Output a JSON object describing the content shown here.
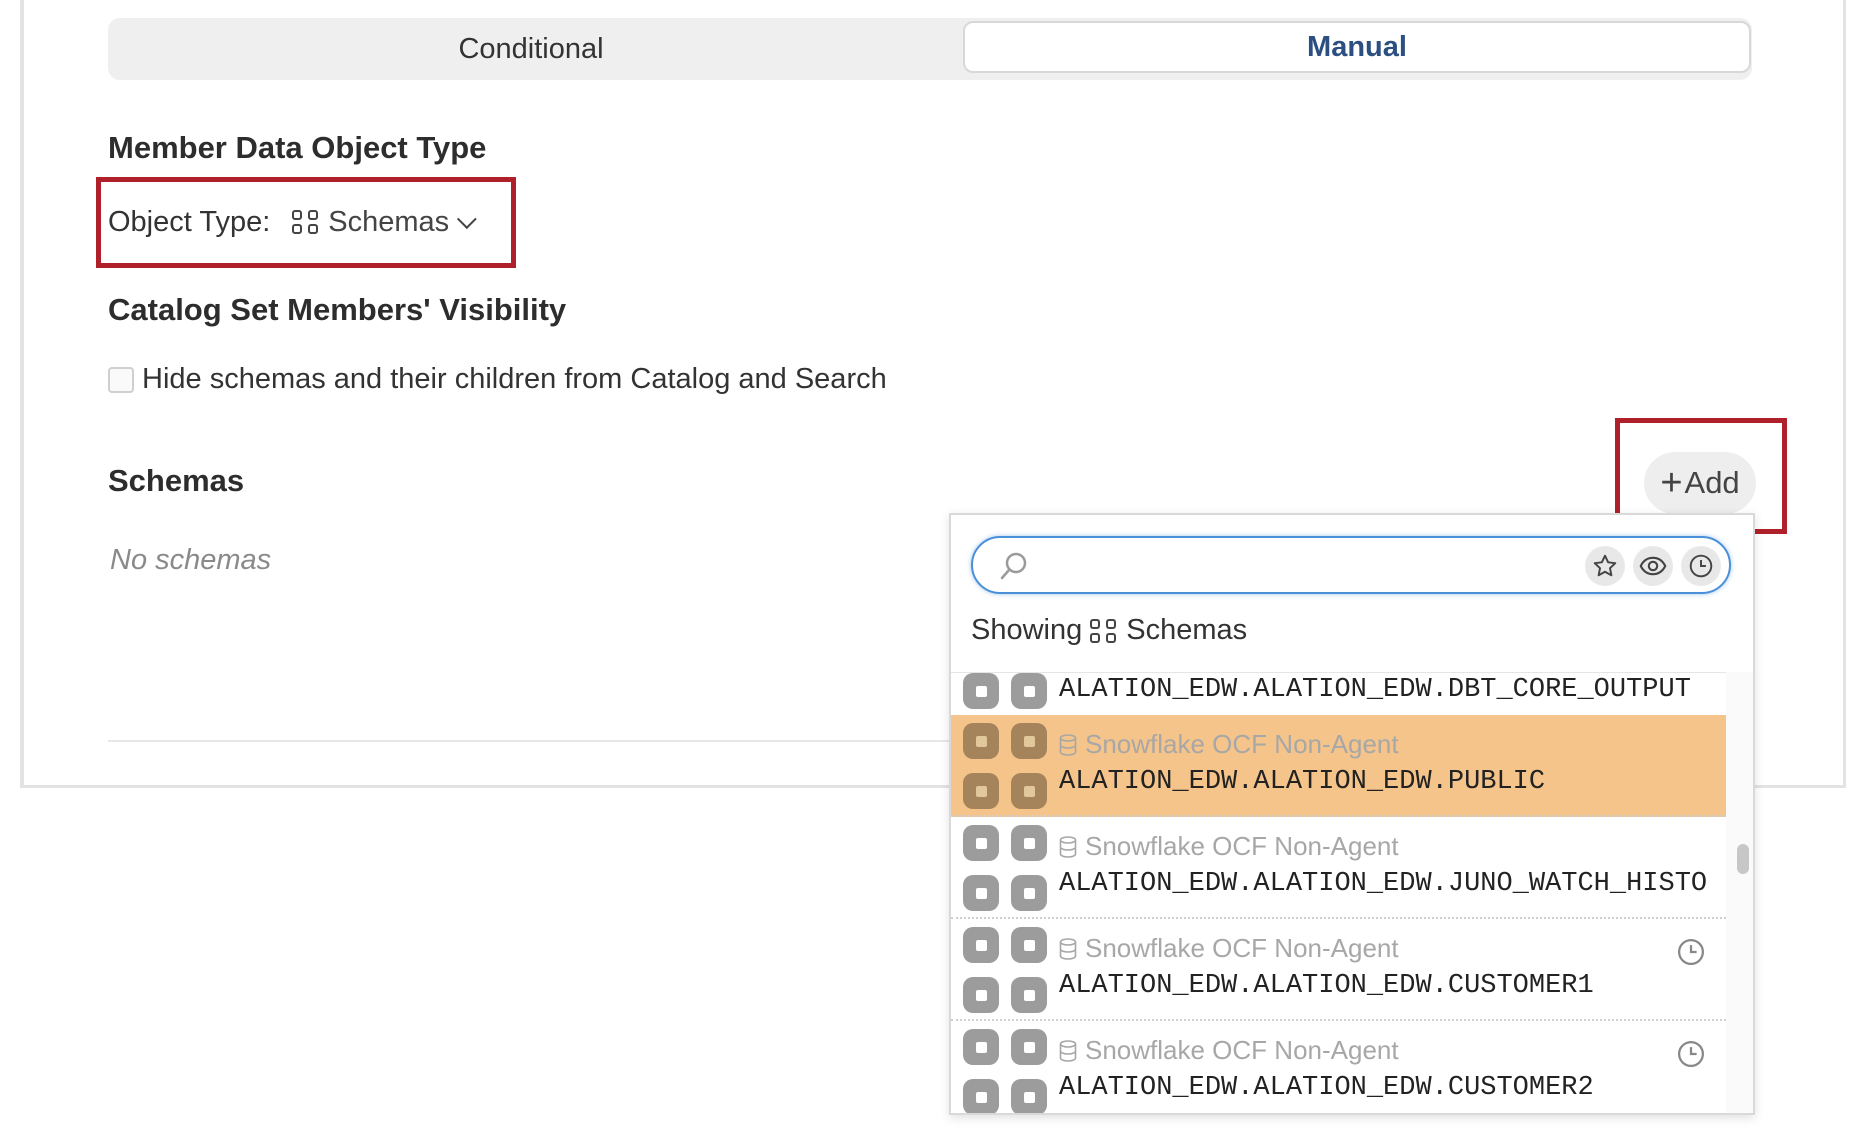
{
  "tabs": {
    "conditional": "Conditional",
    "manual": "Manual",
    "active": "Manual"
  },
  "member_type": {
    "heading": "Member Data Object Type",
    "label": "Object Type:",
    "value": "Schemas",
    "icon": "schema-grid-icon"
  },
  "visibility": {
    "heading": "Catalog Set Members' Visibility",
    "checkbox_label": "Hide schemas and their children from Catalog and Search",
    "checked": false
  },
  "schemas": {
    "heading": "Schemas",
    "empty_text": "No schemas",
    "add_label": "Add"
  },
  "dropdown": {
    "search": {
      "placeholder": "",
      "value": ""
    },
    "filters": [
      "star-icon",
      "eye-icon",
      "clock-icon"
    ],
    "showing_label": "Showing",
    "showing_type": "Schemas",
    "items": [
      {
        "source": "",
        "name": "ALATION_EDW.ALATION_EDW.DBT_CORE_OUTPUT",
        "recent": false,
        "active": false
      },
      {
        "source": "Snowflake OCF Non-Agent",
        "name": "ALATION_EDW.ALATION_EDW.PUBLIC",
        "recent": false,
        "active": true
      },
      {
        "source": "Snowflake OCF Non-Agent",
        "name": "ALATION_EDW.ALATION_EDW.JUNO_WATCH_HISTO",
        "recent": false,
        "active": false
      },
      {
        "source": "Snowflake OCF Non-Agent",
        "name": "ALATION_EDW.ALATION_EDW.CUSTOMER1",
        "recent": true,
        "active": false
      },
      {
        "source": "Snowflake OCF Non-Agent",
        "name": "ALATION_EDW.ALATION_EDW.CUSTOMER2",
        "recent": true,
        "active": false
      }
    ]
  },
  "colors": {
    "highlight": "#b0202a",
    "active_row": "#f4c48a",
    "tab_active_text": "#2b4f80",
    "search_border": "#4a90d9"
  }
}
